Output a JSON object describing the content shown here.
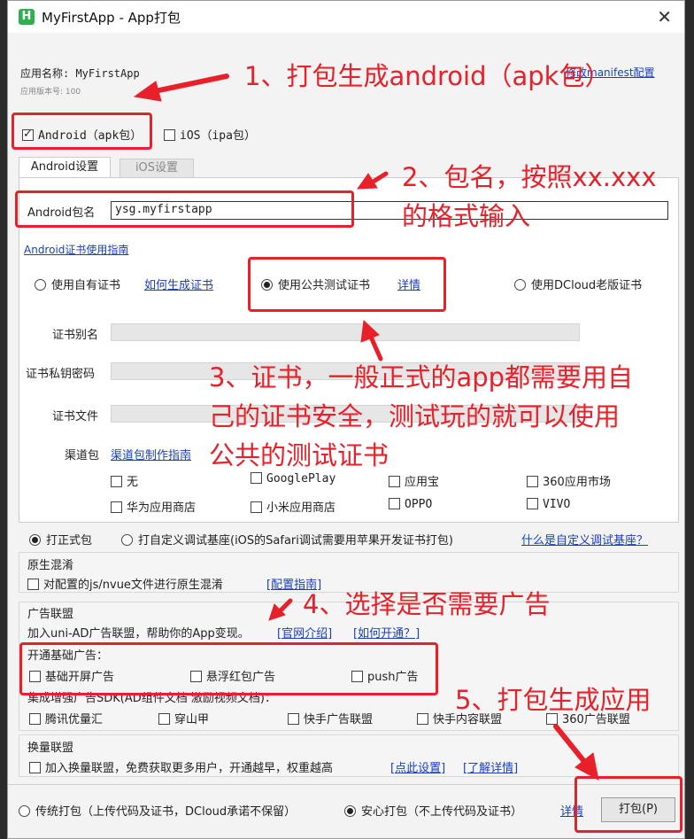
{
  "window": {
    "title": "MyFirstApp - App打包",
    "logo": "H"
  },
  "app_info": {
    "name_label": "应用名称: MyFirstApp",
    "version_label": "应用版本号: 100",
    "manifest_link": "修改manifest配置"
  },
  "platforms": {
    "android": "Android（apk包）",
    "ios": "iOS（ipa包）"
  },
  "tabs": {
    "android": "Android设置",
    "ios": "iOS设置"
  },
  "package": {
    "label": "Android包名",
    "value": "ysg.myfirstapp"
  },
  "cert": {
    "guide_link": "Android证书使用指南",
    "own": "使用自有证书",
    "how_link": "如何生成证书",
    "public": "使用公共测试证书",
    "detail_link": "详情",
    "dcloud": "使用DCloud老版证书",
    "alias": "证书别名",
    "password": "证书私钥密码",
    "file": "证书文件"
  },
  "channels": {
    "label": "渠道包",
    "guide_link": "渠道包制作指南",
    "items": [
      "无",
      "GooglePlay",
      "应用宝",
      "360应用市场",
      "华为应用商店",
      "小米应用商店",
      "OPPO",
      "VIVO"
    ]
  },
  "build_type": {
    "release": "打正式包",
    "custom": "打自定义调试基座(iOS的Safari调试需要用苹果开发证书打包)",
    "custom_link": "什么是自定义调试基座？"
  },
  "obfuscation": {
    "title": "原生混淆",
    "option": "对配置的js/nvue文件进行原生混淆",
    "link": "[配置指南]"
  },
  "ads": {
    "title": "广告联盟",
    "desc": "加入uni-AD广告联盟，帮助你的App变现。",
    "link1": "[官网介绍]",
    "link2": "[如何开通？]",
    "basic_title": "开通基础广告：",
    "basic": [
      "基础开屏广告",
      "悬浮红包广告",
      "push广告"
    ],
    "enhanced_title": "集成增强广告SDK(AD组件文档  激励视频文档)：",
    "enhanced": [
      "腾讯优量汇",
      "穿山甲",
      "快手广告联盟",
      "快手内容联盟",
      "360广告联盟"
    ]
  },
  "exchange": {
    "title": "换量联盟",
    "option": "加入换量联盟，免费获取更多用户，开通越早，权重越高",
    "link1": "[点此设置]",
    "link2": "[了解详情]"
  },
  "footer": {
    "traditional": "传统打包（上传代码及证书，DCloud承诺不保留）",
    "safe": "安心打包（不上传代码及证书）",
    "detail_link": "详情",
    "pack_button": "打包(P)"
  },
  "annotations": {
    "n1": "1、打包生成android（apk包）",
    "n2a": "2、包名，按照xx.xxx",
    "n2b": "的格式输入",
    "n3a": "3、证书，一般正式的app都需要用自",
    "n3b": "己的证书安全，测试玩的就可以使用",
    "n3c": "公共的测试证书",
    "n4": "4、选择是否需要广告",
    "n5": "5、打包生成应用"
  },
  "colors": {
    "annotation": "#e8202a",
    "link": "#1a3fbf",
    "logo": "#2eb050"
  }
}
